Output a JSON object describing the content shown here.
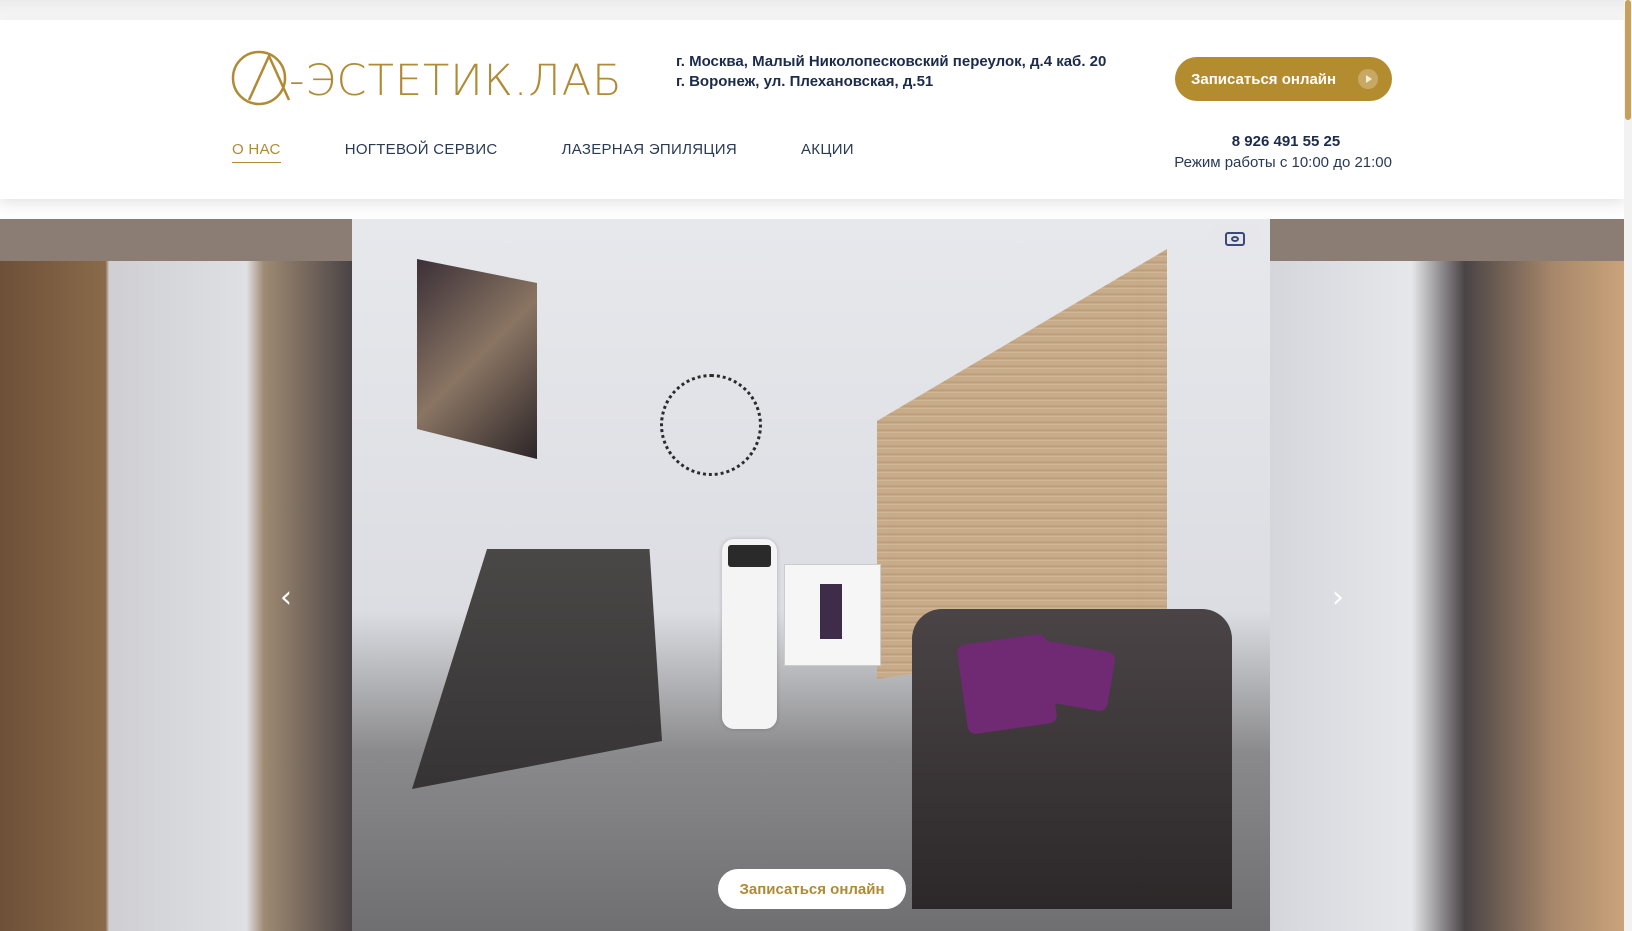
{
  "brand": {
    "logo_text": "-ЭСТЕТИК.ЛАБ",
    "accent": "#b08a34",
    "text_color": "#1c2b4a"
  },
  "header": {
    "address_moscow": "г. Москва, Малый Николопесковский переулок, д.4 каб. 20",
    "address_voronezh": "г. Воронеж, ул. Плехановская, д.51",
    "cta_label": "Записаться онлайн",
    "phone": "8 926 491 55 25",
    "hours": "Режим работы с 10:00 до 21:00"
  },
  "nav": {
    "items": [
      {
        "label": "О НАС",
        "active": true
      },
      {
        "label": "НОГТЕВОЙ СЕРВИС",
        "active": false
      },
      {
        "label": "ЛАЗЕРНАЯ ЭПИЛЯЦИЯ",
        "active": false
      },
      {
        "label": "АКЦИИ",
        "active": false
      }
    ]
  },
  "gallery": {
    "prev_icon": "chevron-left-icon",
    "next_icon": "chevron-right-icon",
    "expand_icon": "expand-icon",
    "cta_label": "Записаться онлайн"
  }
}
